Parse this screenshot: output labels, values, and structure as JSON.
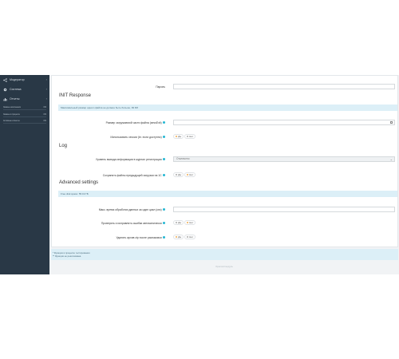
{
  "sidebar": {
    "items": [
      {
        "label": "Модератор",
        "icon": "share-icon"
      },
      {
        "label": "Система",
        "icon": "gear-icon"
      },
      {
        "label": "Отчеты",
        "icon": "bar-chart-icon"
      }
    ],
    "stats": [
      {
        "label": "Заказы наполнения",
        "value": "0%",
        "fill": 0.0
      },
      {
        "label": "Заказы в процессе",
        "value": "0%",
        "fill": 0.0
      },
      {
        "label": "Активные клиенты",
        "value": "0%",
        "fill": 0.0
      }
    ]
  },
  "form": {
    "password_label": "Пароль",
    "init_title": "INIT Response",
    "init_info": "Максимальный размер одного файла не должен быть больше, 99 Mб",
    "chunk_label": "Размер загружаемой части файла (sessExit)",
    "use_sessions_label": "Использовать сессии (br. если доступно)",
    "yes": "Да",
    "no": "Нет",
    "log_title": "Log",
    "log_level_label": "Уровень вывода информации в журнал регистрации",
    "log_level_value": "Отключено",
    "save_prev_label": "Сохранять файлы предыдущей загрузки на 1С",
    "adv_title": "Advanced settings",
    "free_space": "Free disk space: 55.19 ГБ",
    "max_time_label": "Макс. время обработки данных за один цикл (сек)",
    "check_fix_label": "Проверять и исправлять ошибки автоматически",
    "delete_zip_label": "Удалять архив zip после распаковки"
  },
  "footnotes": [
    "* Функция в процессе тестирования",
    "** Функция не реализована"
  ],
  "footer": "Opencart модуль"
}
